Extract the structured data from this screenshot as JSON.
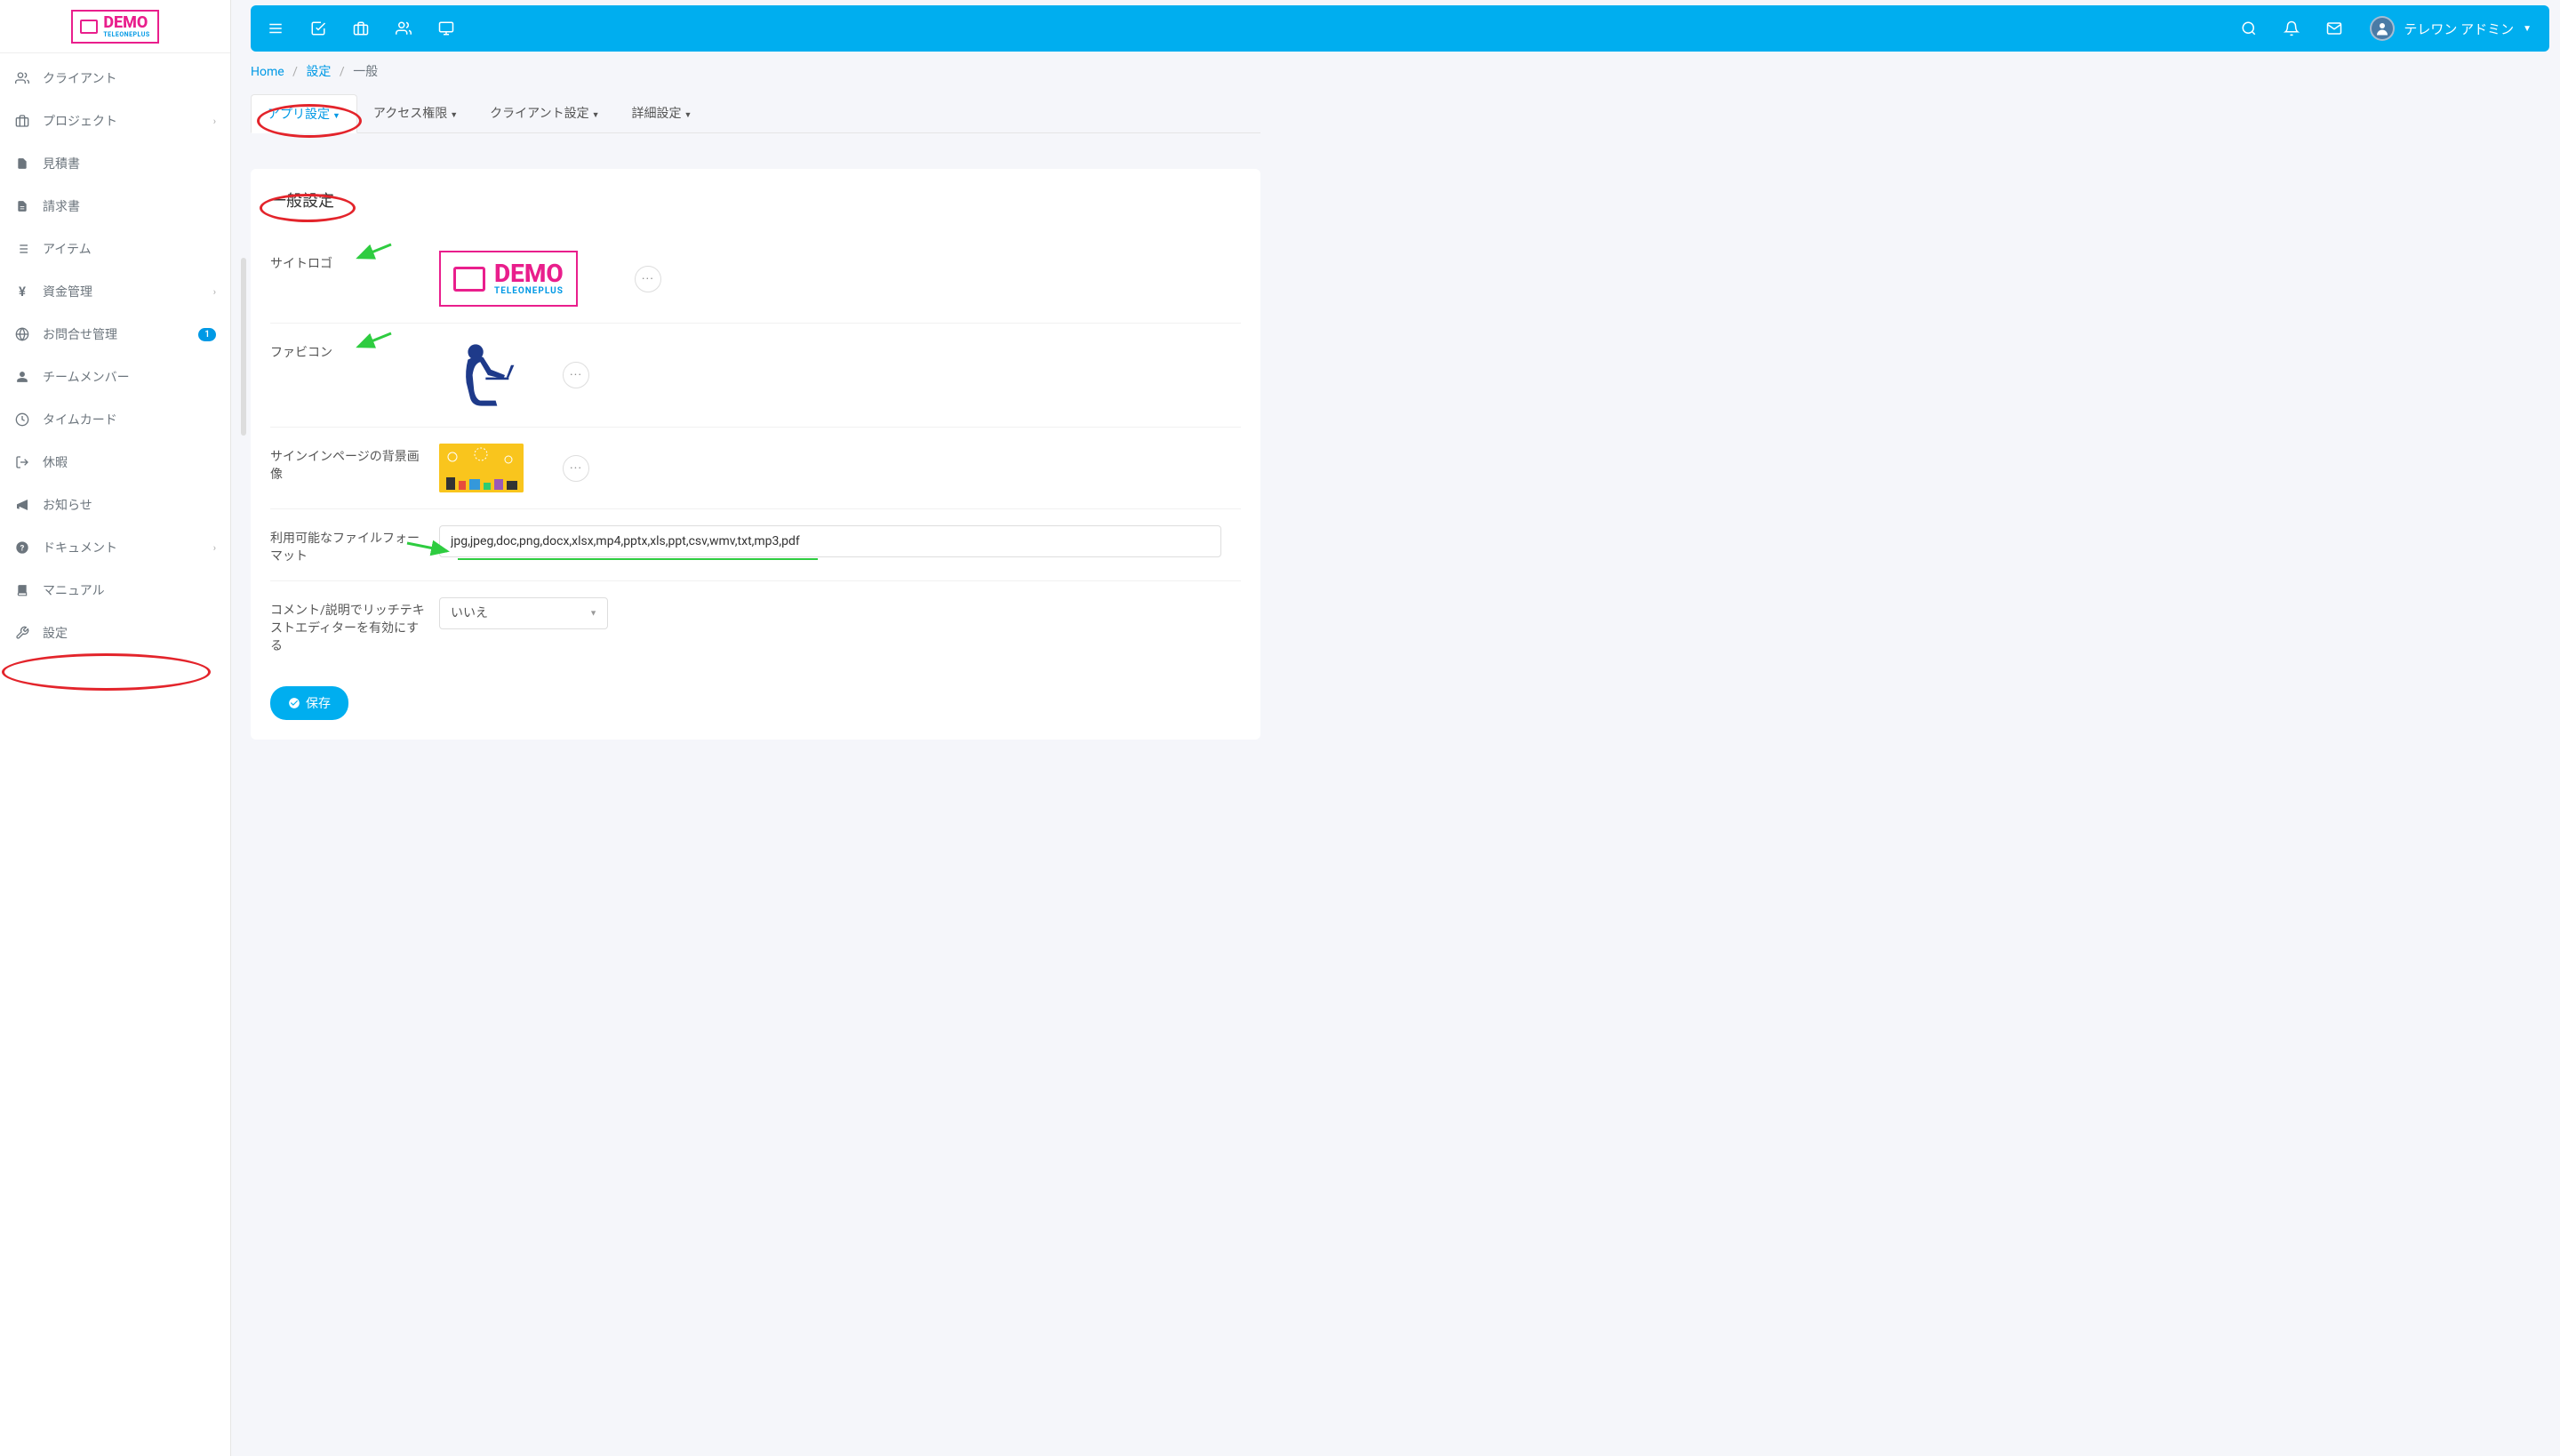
{
  "logo": {
    "main": "DEMO",
    "sub": "TELEONEPLUS"
  },
  "sidebar": {
    "items": [
      {
        "label": "クライアント",
        "icon": "users-icon"
      },
      {
        "label": "プロジェクト",
        "icon": "briefcase-icon",
        "chevron": true
      },
      {
        "label": "見積書",
        "icon": "file-icon"
      },
      {
        "label": "請求書",
        "icon": "file-text-icon"
      },
      {
        "label": "アイテム",
        "icon": "list-icon"
      },
      {
        "label": "資金管理",
        "icon": "yen-icon",
        "chevron": true
      },
      {
        "label": "お問合せ管理",
        "icon": "globe-icon",
        "badge": "1"
      },
      {
        "label": "チームメンバー",
        "icon": "user-icon"
      },
      {
        "label": "タイムカード",
        "icon": "clock-icon"
      },
      {
        "label": "休暇",
        "icon": "logout-icon"
      },
      {
        "label": "お知らせ",
        "icon": "megaphone-icon"
      },
      {
        "label": "ドキュメント",
        "icon": "help-icon",
        "chevron": true
      },
      {
        "label": "マニュアル",
        "icon": "book-icon"
      },
      {
        "label": "設定",
        "icon": "wrench-icon"
      }
    ]
  },
  "topbar": {
    "username": "テレワン アドミン"
  },
  "breadcrumb": {
    "home": "Home",
    "settings": "設定",
    "current": "一般"
  },
  "tabs": [
    {
      "label": "アプリ設定",
      "active": true
    },
    {
      "label": "アクセス権限"
    },
    {
      "label": "クライアント設定"
    },
    {
      "label": "詳細設定"
    }
  ],
  "card": {
    "title": "一般設定",
    "rows": {
      "site_logo": "サイトロゴ",
      "favicon": "ファビコン",
      "signin_bg": "サインインページの背景画像",
      "file_formats_label": "利用可能なファイルフォーマット",
      "file_formats_value": "jpg,jpeg,doc,png,docx,xlsx,mp4,pptx,xls,ppt,csv,wmv,txt,mp3,pdf",
      "rich_text_label": "コメント/説明でリッチテキストエディターを有効にする",
      "rich_text_value": "いいえ"
    },
    "save": "保存"
  }
}
